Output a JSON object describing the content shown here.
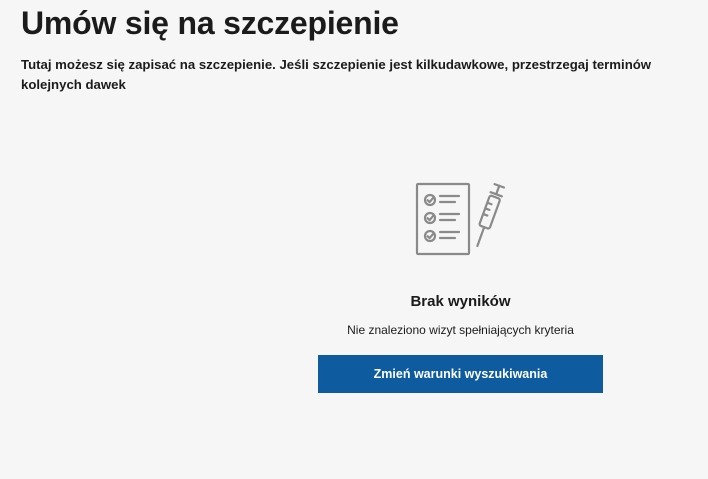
{
  "page": {
    "title": "Umów się na szczepienie",
    "description": "Tutaj możesz się zapisać na szczepienie. Jeśli szczepienie jest kilkudawkowe, przestrzegaj terminów kolejnych dawek"
  },
  "empty_state": {
    "illustration_icon": "checklist-syringe-icon",
    "title": "Brak wyników",
    "message": "Nie znaleziono wizyt spełniających kryteria",
    "button_label": "Zmień warunki wyszukiwania"
  },
  "colors": {
    "background": "#f6f6f6",
    "button": "#0e5b9f",
    "icon": "#8a8a8a"
  }
}
